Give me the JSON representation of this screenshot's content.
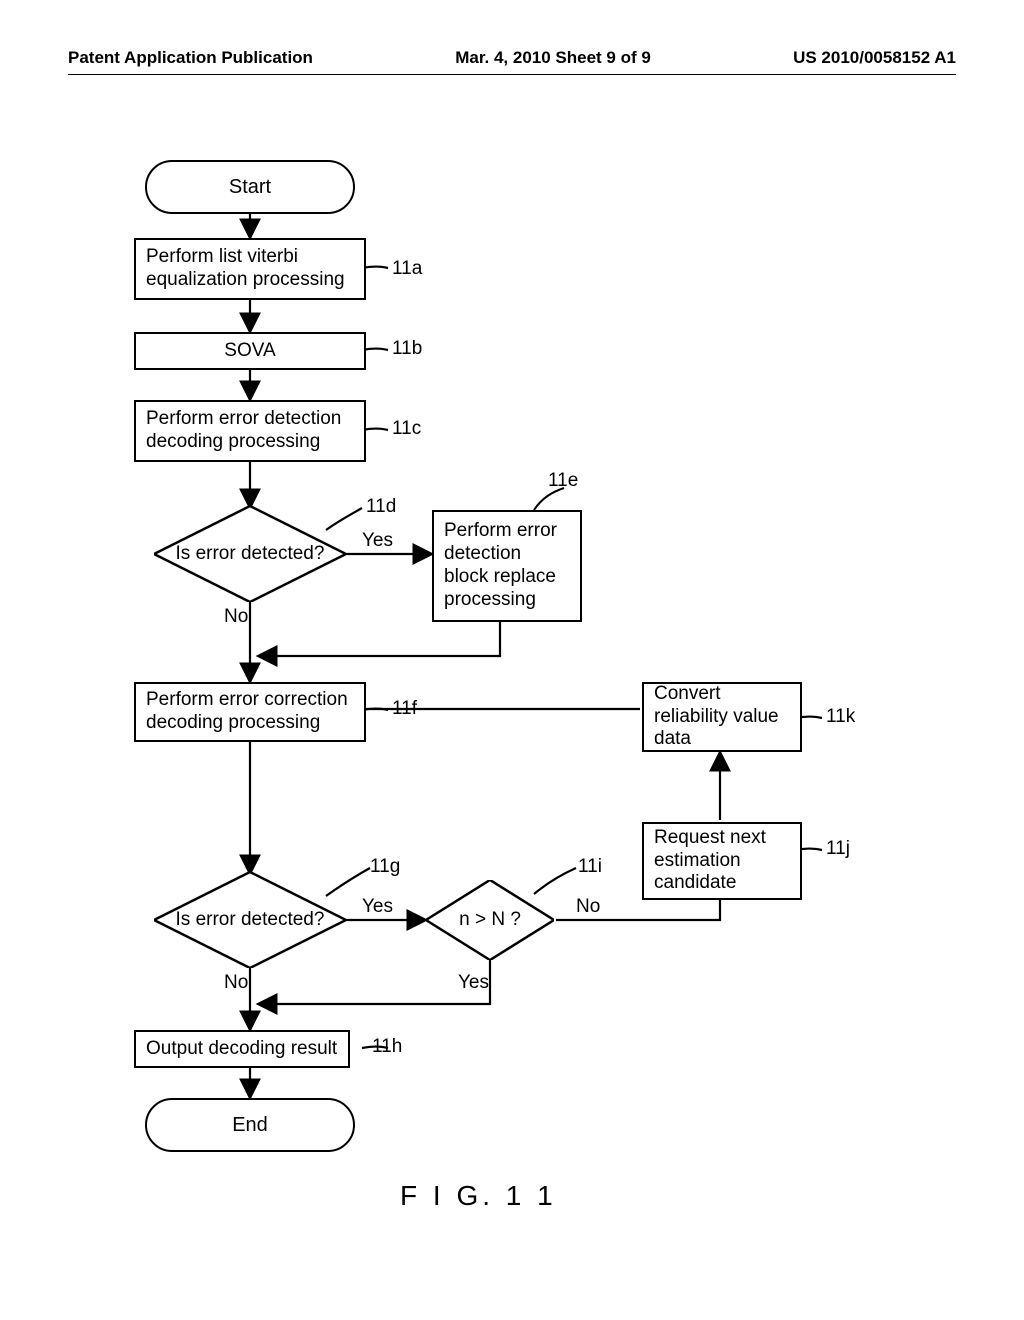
{
  "header": {
    "left": "Patent Application Publication",
    "center": "Mar. 4, 2010  Sheet 9 of 9",
    "right": "US 2010/0058152 A1"
  },
  "flow": {
    "start": "Start",
    "s11a": "Perform list viterbi equalization processing",
    "s11b": "SOVA",
    "s11c": "Perform error detection decoding processing",
    "s11d": "Is error detected?",
    "s11e": "Perform error detection block replace processing",
    "s11f": "Perform error correction decoding processing",
    "s11g": "Is error detected?",
    "s11i": "n > N ?",
    "s11j": "Request next estimation candidate",
    "s11k": "Convert reliability value data",
    "s11h": "Output decoding result",
    "end": "End"
  },
  "labels": {
    "r11a": "11a",
    "r11b": "11b",
    "r11c": "11c",
    "r11d": "11d",
    "r11e": "11e",
    "r11f": "11f",
    "r11g": "11g",
    "r11h": "11h",
    "r11i": "11i",
    "r11j": "11j",
    "r11k": "11k",
    "yes": "Yes",
    "no": "No"
  },
  "figure_caption": "F I G. 1 1",
  "chart_data": {
    "type": "flowchart",
    "nodes": [
      {
        "id": "start",
        "type": "terminal",
        "text": "Start"
      },
      {
        "id": "11a",
        "type": "process",
        "text": "Perform list viterbi equalization processing"
      },
      {
        "id": "11b",
        "type": "process",
        "text": "SOVA"
      },
      {
        "id": "11c",
        "type": "process",
        "text": "Perform error detection decoding processing"
      },
      {
        "id": "11d",
        "type": "decision",
        "text": "Is error detected?"
      },
      {
        "id": "11e",
        "type": "process",
        "text": "Perform error detection block replace processing"
      },
      {
        "id": "11f",
        "type": "process",
        "text": "Perform error correction decoding processing"
      },
      {
        "id": "11g",
        "type": "decision",
        "text": "Is error detected?"
      },
      {
        "id": "11i",
        "type": "decision",
        "text": "n > N ?"
      },
      {
        "id": "11j",
        "type": "process",
        "text": "Request next estimation candidate"
      },
      {
        "id": "11k",
        "type": "process",
        "text": "Convert reliability value data"
      },
      {
        "id": "11h",
        "type": "process",
        "text": "Output decoding result"
      },
      {
        "id": "end",
        "type": "terminal",
        "text": "End"
      }
    ],
    "edges": [
      {
        "from": "start",
        "to": "11a"
      },
      {
        "from": "11a",
        "to": "11b"
      },
      {
        "from": "11b",
        "to": "11c"
      },
      {
        "from": "11c",
        "to": "11d"
      },
      {
        "from": "11d",
        "to": "11e",
        "label": "Yes"
      },
      {
        "from": "11d",
        "to": "11f",
        "label": "No",
        "via": "merge1"
      },
      {
        "from": "11e",
        "to": "merge1"
      },
      {
        "from": "merge1",
        "to": "11f"
      },
      {
        "from": "11f",
        "to": "11g"
      },
      {
        "from": "11g",
        "to": "11i",
        "label": "Yes"
      },
      {
        "from": "11g",
        "to": "merge2",
        "label": "No"
      },
      {
        "from": "11i",
        "to": "merge2",
        "label": "Yes"
      },
      {
        "from": "11i",
        "to": "11j",
        "label": "No"
      },
      {
        "from": "11j",
        "to": "11k"
      },
      {
        "from": "11k",
        "to": "merge1"
      },
      {
        "from": "merge2",
        "to": "11h"
      },
      {
        "from": "11h",
        "to": "end"
      }
    ]
  }
}
